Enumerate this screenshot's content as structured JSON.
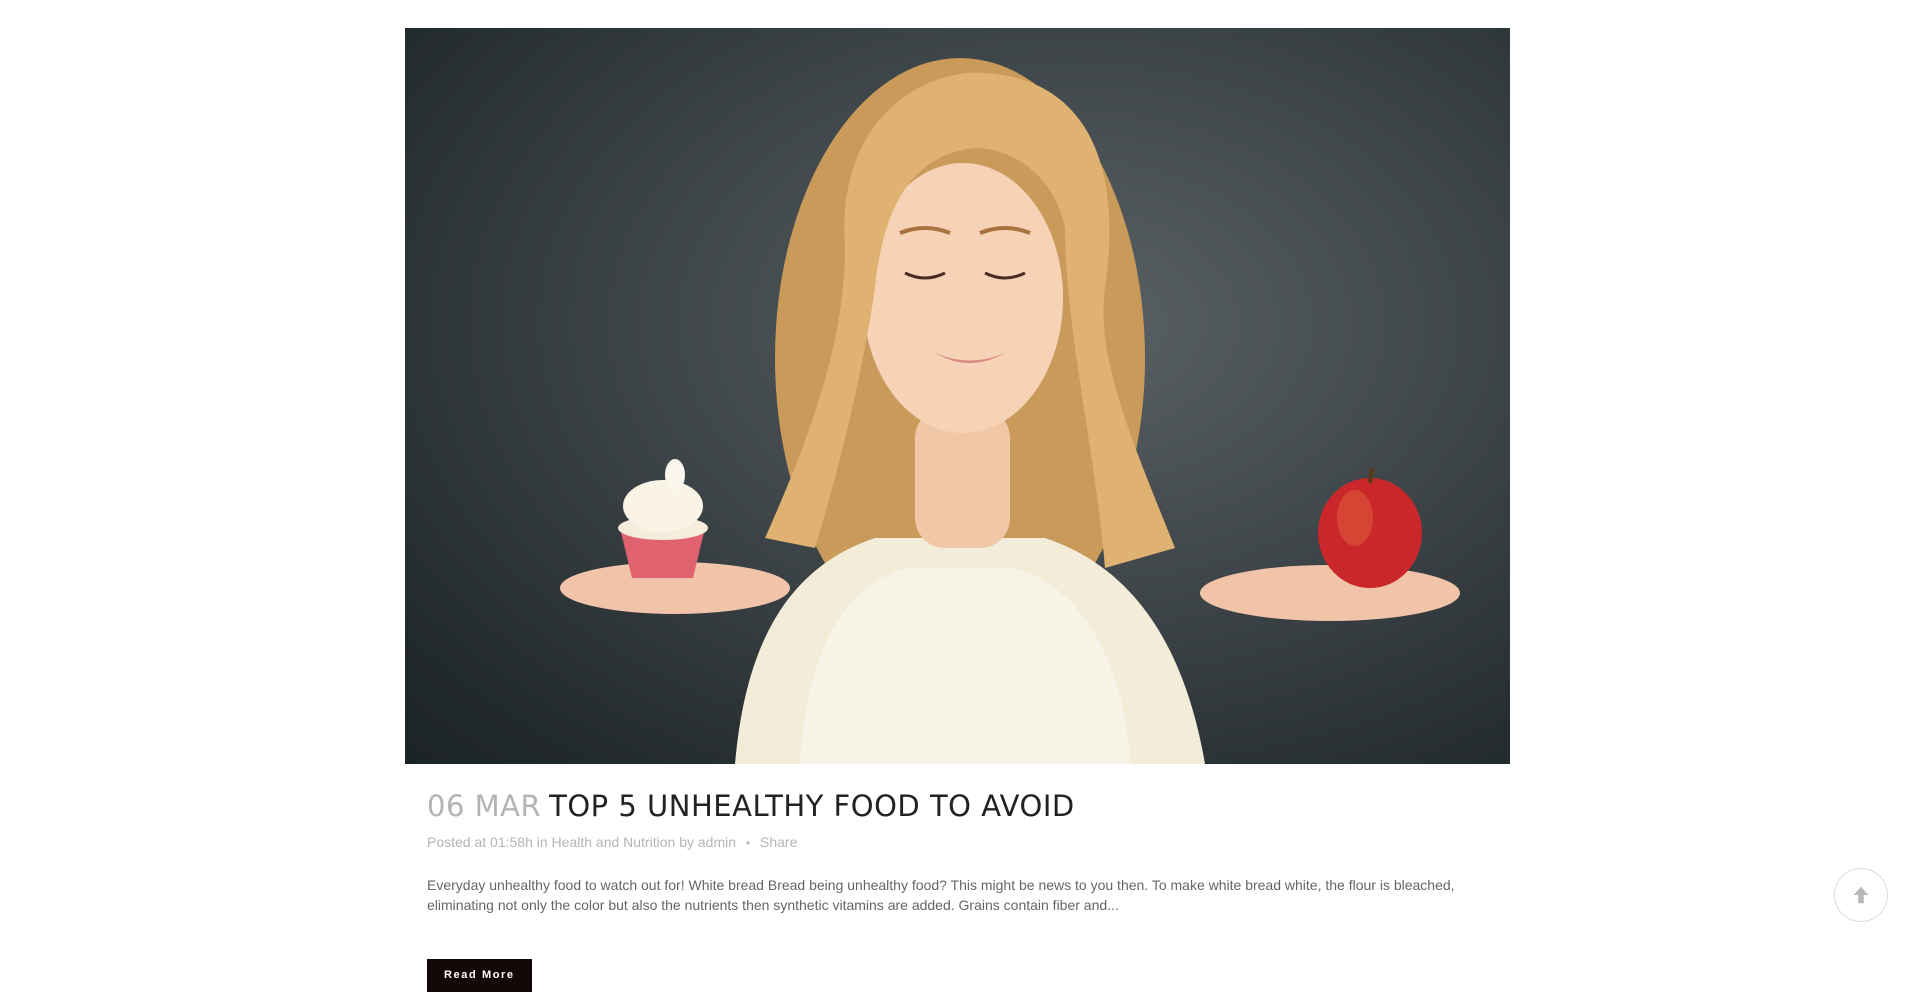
{
  "post": {
    "image_alt": "Woman holding a cupcake and an apple",
    "date": "06 MAR",
    "title": "TOP 5 UNHEALTHY FOOD TO AVOID",
    "meta": {
      "posted_prefix": "Posted at",
      "time": "01:58h",
      "in_word": "in",
      "category": "Health and Nutrition",
      "by_word": "by",
      "author": "admin",
      "separator": "•",
      "share": "Share"
    },
    "excerpt": "Everyday unhealthy food to watch out for! White bread Bread being unhealthy food? This might be news to you then. To make white bread white, the flour is bleached, eliminating not only the color but also the nutrients then synthetic vitamins are added. Grains contain fiber and...",
    "read_more": "Read More"
  },
  "back_to_top": {
    "icon": "arrow-up-icon"
  },
  "colors": {
    "date": "#b4b4b4",
    "title": "#222222",
    "meta": "#b5b5b5",
    "excerpt": "#666666",
    "button_bg": "#140707",
    "button_text": "#ffffff"
  }
}
